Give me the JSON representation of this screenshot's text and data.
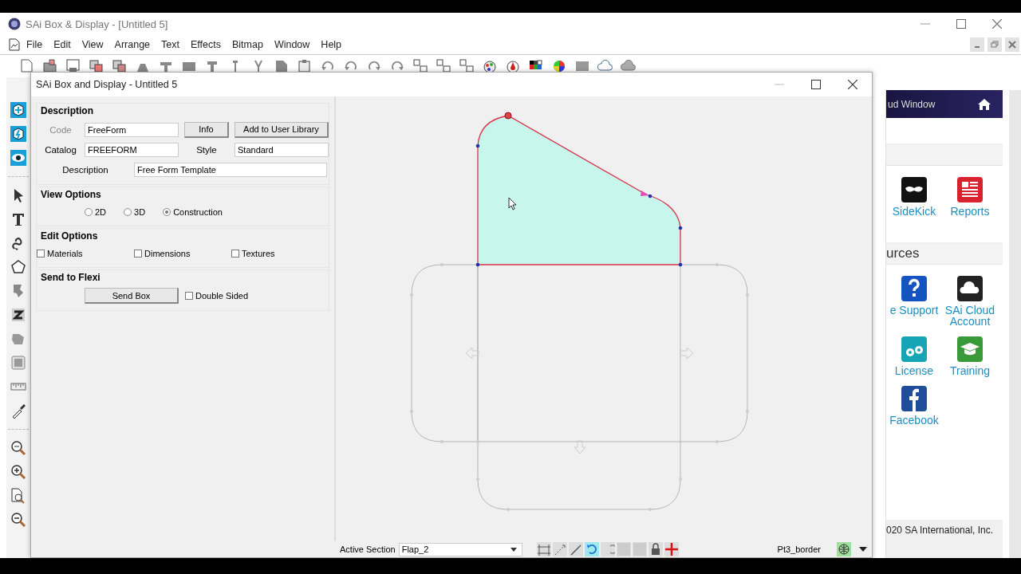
{
  "app": {
    "title": "SAi Box & Display - [Untitled 5]",
    "menu": [
      "File",
      "Edit",
      "View",
      "Arrange",
      "Text",
      "Effects",
      "Bitmap",
      "Window",
      "Help"
    ]
  },
  "dialog": {
    "title": "SAi Box and Display - Untitled 5",
    "description": {
      "heading": "Description",
      "code": {
        "label": "Code",
        "value": "FreeForm",
        "disabled": true
      },
      "info_button": "Info",
      "library_button": "Add to User Library",
      "catalog": {
        "label": "Catalog",
        "value": "FREEFORM"
      },
      "style": {
        "label": "Style",
        "value": "Standard"
      },
      "description": {
        "label": "Description",
        "value": "Free Form Template"
      }
    },
    "view_options": {
      "heading": "View Options",
      "options": [
        {
          "label": "2D",
          "selected": false
        },
        {
          "label": "3D",
          "selected": false
        },
        {
          "label": "Construction",
          "selected": true
        }
      ]
    },
    "edit_options": {
      "heading": "Edit Options",
      "options": [
        {
          "label": "Materials",
          "checked": false
        },
        {
          "label": "Dimensions",
          "checked": false
        },
        {
          "label": "Textures",
          "checked": false
        }
      ]
    },
    "send_to_flexi": {
      "heading": "Send to Flexi",
      "button": "Send Box",
      "double_sided": {
        "label": "Double Sided",
        "checked": false
      }
    },
    "status_bar": {
      "label": "Active Section",
      "section": "Flap_2",
      "element": "Pt3_border"
    }
  },
  "side_panel": {
    "header": "ud Window",
    "sections": [
      {
        "items": [
          {
            "label": "SideKick"
          },
          {
            "label": "Reports"
          }
        ]
      },
      {
        "heading": "urces",
        "items": [
          {
            "label": "e Support"
          },
          {
            "label": "SAi Cloud Account"
          },
          {
            "label": "License"
          },
          {
            "label": "Training"
          },
          {
            "label": "Facebook"
          }
        ]
      }
    ],
    "footer": "020 SA International, Inc."
  }
}
